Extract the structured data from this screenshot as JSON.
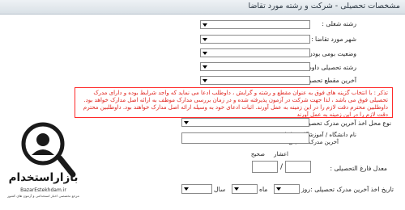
{
  "header": {
    "title": "مشخصات تحصیلی - شرکت و رشته مورد تقاضا"
  },
  "fields": {
    "job_field": {
      "label": "رشته شغلی :"
    },
    "city": {
      "label": "شهر مورد تقاضا :"
    },
    "native_status": {
      "label": "وضعیت بومی بودن داوطلب :"
    },
    "study_field": {
      "label": "رشته تحصیلی داوطلب :"
    },
    "last_degree": {
      "label": "آخرین مقطع تحصیلی داوطلب :"
    },
    "degree_place_type": {
      "label": "نوع محل اخذ آخرین مدرک تحصیلی :"
    },
    "university_name": {
      "label_line1": "نام دانشگاه / آموزشگاه محل اخذ",
      "label_line2": "آخرین مدرک تحصیلی :"
    },
    "gpa": {
      "label": "معدل فارغ التحصیلی :",
      "integer_label": "صحیح",
      "decimal_label": "اعشار",
      "separator": "/"
    },
    "grad_date": {
      "label": "تاریخ اخذ آخرین مدرک تحصیلی :",
      "day_label": "روز",
      "month_label": "ماه",
      "year_label": "سال"
    }
  },
  "notice": {
    "text": "تذکر : با انتخاب گزینه های فوق به عنوان مقطع و رشته و گرایش ، داوطلب ادعا می نماید که واجد شرایط بوده و دارای مدرک تحصیلی فوق می باشد ، لذا جهت شرکت در آزمون پذیرفته شده و در زمان بررسی مدارک موظف به ارائه اصل مدارک خواهد بود. داوطلبین محترم دقت لازم را در این زمینه به عمل آورند. اثبات ادعای خود به وسیله ارائه اصل مدارک خواهند بود. داوطلبین محترم دقت لازم را در این زمینه به عمل آورند"
  },
  "logo": {
    "text": "بازاراستخدام",
    "subtext": "BazarEstekhdam.ir",
    "tagline": "مرجع تخصصی اخبار استخدامی و آزمون های کشور",
    "color": "#1a1a1a"
  },
  "colors": {
    "notice_red": "#e0231d",
    "header_bg": "#dde4ea"
  }
}
